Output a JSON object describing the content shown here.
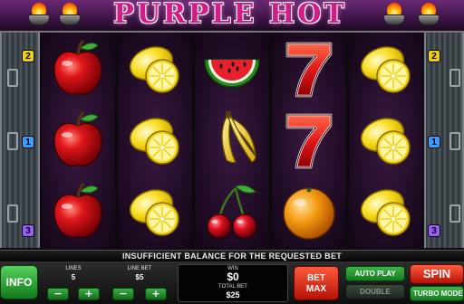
{
  "game": {
    "title": "PURPLE HOT"
  },
  "reels": [
    [
      "apple",
      "apple",
      "apple"
    ],
    [
      "lemon",
      "lemon",
      "lemon"
    ],
    [
      "watermelon",
      "banana",
      "cherry"
    ],
    [
      "seven",
      "seven",
      "orange"
    ],
    [
      "lemon",
      "lemon",
      "lemon"
    ]
  ],
  "paylines": {
    "left": [
      "2",
      "1",
      "3"
    ],
    "right": [
      "2",
      "1",
      "3"
    ],
    "colors": {
      "1": "#3a9cff",
      "2": "#f0d000",
      "3": "#9a5cff"
    }
  },
  "message": "INSUFFICIENT BALANCE FOR THE REQUESTED BET",
  "controls": {
    "info_label": "INFO",
    "lines": {
      "label": "LINES",
      "value": "5",
      "minus": "−",
      "plus": "+"
    },
    "line_bet": {
      "label": "LINE BET",
      "value": "$5",
      "minus": "−",
      "plus": "+"
    },
    "win": {
      "label": "WIN",
      "value": "$0"
    },
    "total_bet": {
      "label": "TOTAL BET",
      "value": "$25"
    },
    "bet_max_line1": "BET",
    "bet_max_line2": "MAX",
    "autoplay_label": "AUTO PLAY",
    "double_label": "DOUBLE",
    "spin_label": "SPIN",
    "turbo_label": "TURBO MODE"
  },
  "colors": {
    "logo": "#d21c87",
    "green_button": "#2a9a34",
    "red_button": "#d8281a",
    "reel_bg": "#2a1230"
  }
}
